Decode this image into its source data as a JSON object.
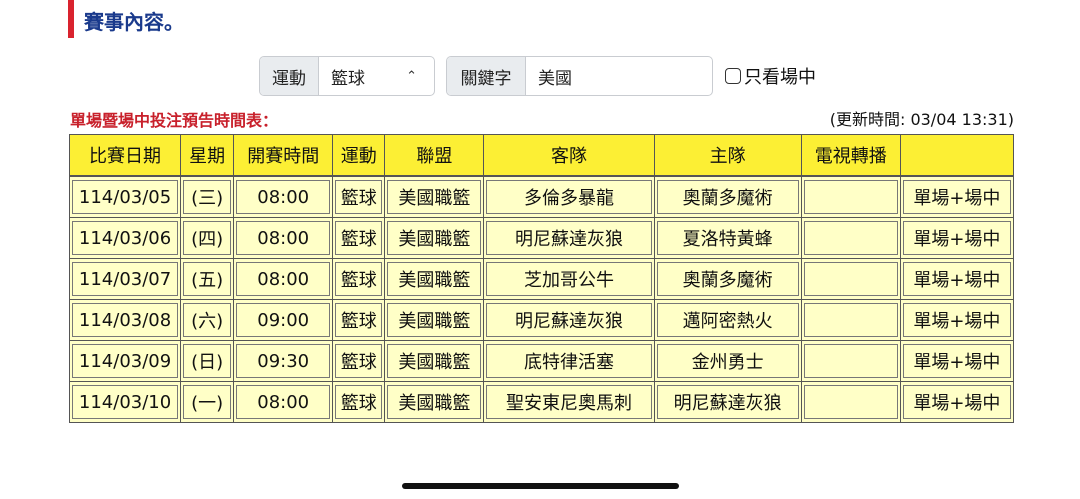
{
  "notice": {
    "line2": "賽事內容。"
  },
  "filters": {
    "sport_label": "運動",
    "sport_value": "籃球",
    "keyword_label": "關鍵字",
    "keyword_value": "美國",
    "live_only_label": "只看場中",
    "live_only_checked": false
  },
  "schedule": {
    "title": "單場暨場中投注預告時間表：",
    "updated": "(更新時間: 03/04 13:31)",
    "headers": [
      "比賽日期",
      "星期",
      "開賽時間",
      "運動",
      "聯盟",
      "客隊",
      "主隊",
      "電視轉播",
      ""
    ],
    "rows": [
      [
        "114/03/05",
        "(三)",
        "08:00",
        "籃球",
        "美國職籃",
        "多倫多暴龍",
        "奧蘭多魔術",
        "",
        "單場+場中"
      ],
      [
        "114/03/06",
        "(四)",
        "08:00",
        "籃球",
        "美國職籃",
        "明尼蘇達灰狼",
        "夏洛特黃蜂",
        "",
        "單場+場中"
      ],
      [
        "114/03/07",
        "(五)",
        "08:00",
        "籃球",
        "美國職籃",
        "芝加哥公牛",
        "奧蘭多魔術",
        "",
        "單場+場中"
      ],
      [
        "114/03/08",
        "(六)",
        "09:00",
        "籃球",
        "美國職籃",
        "明尼蘇達灰狼",
        "邁阿密熱火",
        "",
        "單場+場中"
      ],
      [
        "114/03/09",
        "(日)",
        "09:30",
        "籃球",
        "美國職籃",
        "底特律活塞",
        "金州勇士",
        "",
        "單場+場中"
      ],
      [
        "114/03/10",
        "(一)",
        "08:00",
        "籃球",
        "美國職籃",
        "聖安東尼奧馬刺",
        "明尼蘇達灰狼",
        "",
        "單場+場中"
      ]
    ]
  },
  "colors": {
    "accent_red": "#d9232e",
    "notice_blue": "#1a3a8c",
    "header_yellow": "#fcef34",
    "row_yellow": "#ffffc7"
  }
}
